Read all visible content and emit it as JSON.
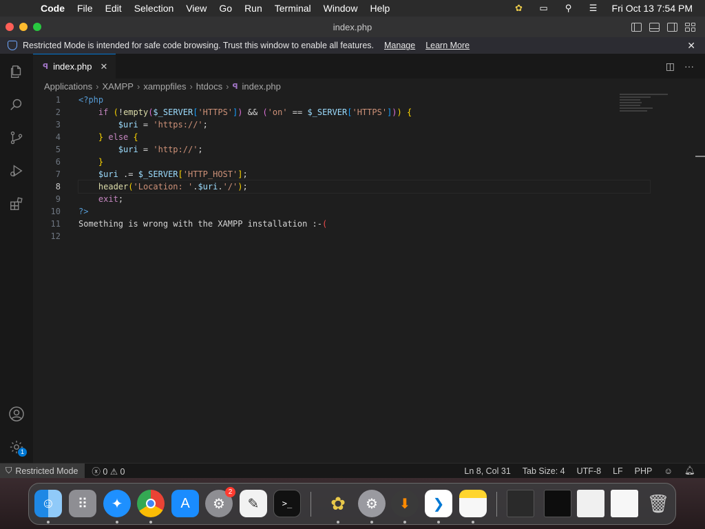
{
  "menubar": {
    "items": [
      "Code",
      "File",
      "Edit",
      "Selection",
      "View",
      "Go",
      "Run",
      "Terminal",
      "Window",
      "Help"
    ],
    "clock": "Fri Oct 13  7:54 PM",
    "status_icons": [
      "cyberduck-icon",
      "screen-mirroring-icon",
      "spotlight-search-icon",
      "control-center-icon"
    ]
  },
  "window": {
    "title": "index.php"
  },
  "banner": {
    "text": "Restricted Mode is intended for safe code browsing. Trust this window to enable all features.",
    "manage_label": "Manage",
    "learn_more_label": "Learn More"
  },
  "tabs": [
    {
      "label": "index.php"
    }
  ],
  "breadcrumb": [
    "Applications",
    "XAMPP",
    "xamppfiles",
    "htdocs",
    "index.php"
  ],
  "editor": {
    "current_line": 8,
    "line_numbers": [
      "1",
      "2",
      "3",
      "4",
      "5",
      "6",
      "7",
      "8",
      "9",
      "10",
      "11",
      "12"
    ],
    "lines": [
      [
        {
          "t": "<?php",
          "c": "tag"
        }
      ],
      [
        {
          "t": "    ",
          "c": "plain"
        },
        {
          "t": "if",
          "c": "ctl"
        },
        {
          "t": " ",
          "c": "plain"
        },
        {
          "t": "(",
          "c": "br1"
        },
        {
          "t": "!",
          "c": "op"
        },
        {
          "t": "empty",
          "c": "fn"
        },
        {
          "t": "(",
          "c": "br2"
        },
        {
          "t": "$_SERVER",
          "c": "var"
        },
        {
          "t": "[",
          "c": "br3"
        },
        {
          "t": "'HTTPS'",
          "c": "str"
        },
        {
          "t": "]",
          "c": "br3"
        },
        {
          "t": ")",
          "c": "br2"
        },
        {
          "t": " && ",
          "c": "op"
        },
        {
          "t": "(",
          "c": "br2"
        },
        {
          "t": "'on'",
          "c": "str"
        },
        {
          "t": " == ",
          "c": "op"
        },
        {
          "t": "$_SERVER",
          "c": "var"
        },
        {
          "t": "[",
          "c": "br3"
        },
        {
          "t": "'HTTPS'",
          "c": "str"
        },
        {
          "t": "]",
          "c": "br3"
        },
        {
          "t": ")",
          "c": "br2"
        },
        {
          "t": ")",
          "c": "br1"
        },
        {
          "t": " ",
          "c": "plain"
        },
        {
          "t": "{",
          "c": "br1"
        }
      ],
      [
        {
          "t": "        ",
          "c": "plain"
        },
        {
          "t": "$uri",
          "c": "var"
        },
        {
          "t": " = ",
          "c": "op"
        },
        {
          "t": "'https://'",
          "c": "str"
        },
        {
          "t": ";",
          "c": "plain"
        }
      ],
      [
        {
          "t": "    ",
          "c": "plain"
        },
        {
          "t": "}",
          "c": "br1"
        },
        {
          "t": " ",
          "c": "plain"
        },
        {
          "t": "else",
          "c": "ctl"
        },
        {
          "t": " ",
          "c": "plain"
        },
        {
          "t": "{",
          "c": "br1"
        }
      ],
      [
        {
          "t": "        ",
          "c": "plain"
        },
        {
          "t": "$uri",
          "c": "var"
        },
        {
          "t": " = ",
          "c": "op"
        },
        {
          "t": "'http://'",
          "c": "str"
        },
        {
          "t": ";",
          "c": "plain"
        }
      ],
      [
        {
          "t": "    ",
          "c": "plain"
        },
        {
          "t": "}",
          "c": "br1"
        }
      ],
      [
        {
          "t": "    ",
          "c": "plain"
        },
        {
          "t": "$uri",
          "c": "var"
        },
        {
          "t": " .= ",
          "c": "op"
        },
        {
          "t": "$_SERVER",
          "c": "var"
        },
        {
          "t": "[",
          "c": "br1"
        },
        {
          "t": "'HTTP_HOST'",
          "c": "str"
        },
        {
          "t": "]",
          "c": "br1"
        },
        {
          "t": ";",
          "c": "plain"
        }
      ],
      [
        {
          "t": "    ",
          "c": "plain"
        },
        {
          "t": "header",
          "c": "fn"
        },
        {
          "t": "(",
          "c": "br1"
        },
        {
          "t": "'Location: '",
          "c": "str"
        },
        {
          "t": ".",
          "c": "op"
        },
        {
          "t": "$uri",
          "c": "var"
        },
        {
          "t": ".",
          "c": "op"
        },
        {
          "t": "'/'",
          "c": "str"
        },
        {
          "t": ")",
          "c": "br1"
        },
        {
          "t": ";",
          "c": "plain"
        }
      ],
      [
        {
          "t": "    ",
          "c": "plain"
        },
        {
          "t": "exit",
          "c": "ctl"
        },
        {
          "t": ";",
          "c": "plain"
        }
      ],
      [
        {
          "t": "?>",
          "c": "tag"
        }
      ],
      [
        {
          "t": "Something is wrong with the XAMPP installation :-",
          "c": "plain"
        },
        {
          "t": "(",
          "c": "err"
        }
      ],
      [
        {
          "t": "",
          "c": "plain"
        }
      ]
    ]
  },
  "statusbar": {
    "restricted_label": "Restricted Mode",
    "errors": "0",
    "warnings": "0",
    "cursor_position": "Ln 8, Col 31",
    "tab_size": "Tab Size: 4",
    "encoding": "UTF-8",
    "eol": "LF",
    "language": "PHP"
  },
  "activity_bar": {
    "items": [
      "explorer-icon",
      "search-icon",
      "source-control-icon",
      "run-debug-icon",
      "extensions-icon",
      "accounts-icon",
      "manage-gear-icon"
    ],
    "manage_badge": "1"
  },
  "dock": {
    "apps": [
      {
        "name": "finder",
        "running": true
      },
      {
        "name": "launchpad",
        "running": false
      },
      {
        "name": "safari",
        "running": true
      },
      {
        "name": "chrome",
        "running": true
      },
      {
        "name": "app-store",
        "running": false
      },
      {
        "name": "system-settings",
        "running": false,
        "badge": "2"
      },
      {
        "name": "script-editor",
        "running": false
      },
      {
        "name": "terminal",
        "running": false
      },
      {
        "name": "cyberduck",
        "running": true
      },
      {
        "name": "system-preferences",
        "running": true
      },
      {
        "name": "downloader",
        "running": true
      },
      {
        "name": "vscode",
        "running": true
      },
      {
        "name": "notes",
        "running": true
      }
    ],
    "minimized": [
      "window-thumbnail-1",
      "window-thumbnail-2",
      "window-thumbnail-3",
      "window-thumbnail-4",
      "trash"
    ]
  },
  "colors": {
    "accent": "#0078d4",
    "editor_bg": "#1e1e1e",
    "sidebar_bg": "#181818",
    "banner_bg": "#2c2c32"
  }
}
